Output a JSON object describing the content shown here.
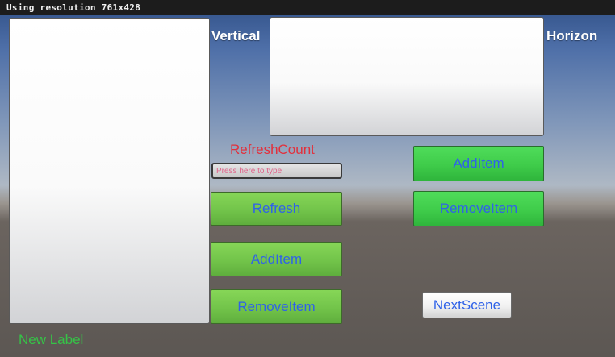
{
  "header": {
    "resolution_text": "Using resolution 761x428"
  },
  "vertical_panel": {
    "label": "Vertical"
  },
  "horizontal_panel": {
    "label": "Horizon"
  },
  "refresh_count": {
    "label": "RefreshCount"
  },
  "input": {
    "placeholder": "Press here to type",
    "value": ""
  },
  "buttons": {
    "refresh": "Refresh",
    "add_item_left": "AddItem",
    "remove_item_left": "RemoveItem",
    "add_item_right": "AddItem",
    "remove_item_right": "RemoveItem",
    "next_scene": "NextScene"
  },
  "footer": {
    "new_label": "New Label"
  },
  "colors": {
    "green_button": "#72c44a",
    "bright_green_button": "#3fcc4a",
    "button_text": "#2f62e8",
    "refresh_count_text": "#e2303c",
    "new_label_text": "#35c447"
  }
}
